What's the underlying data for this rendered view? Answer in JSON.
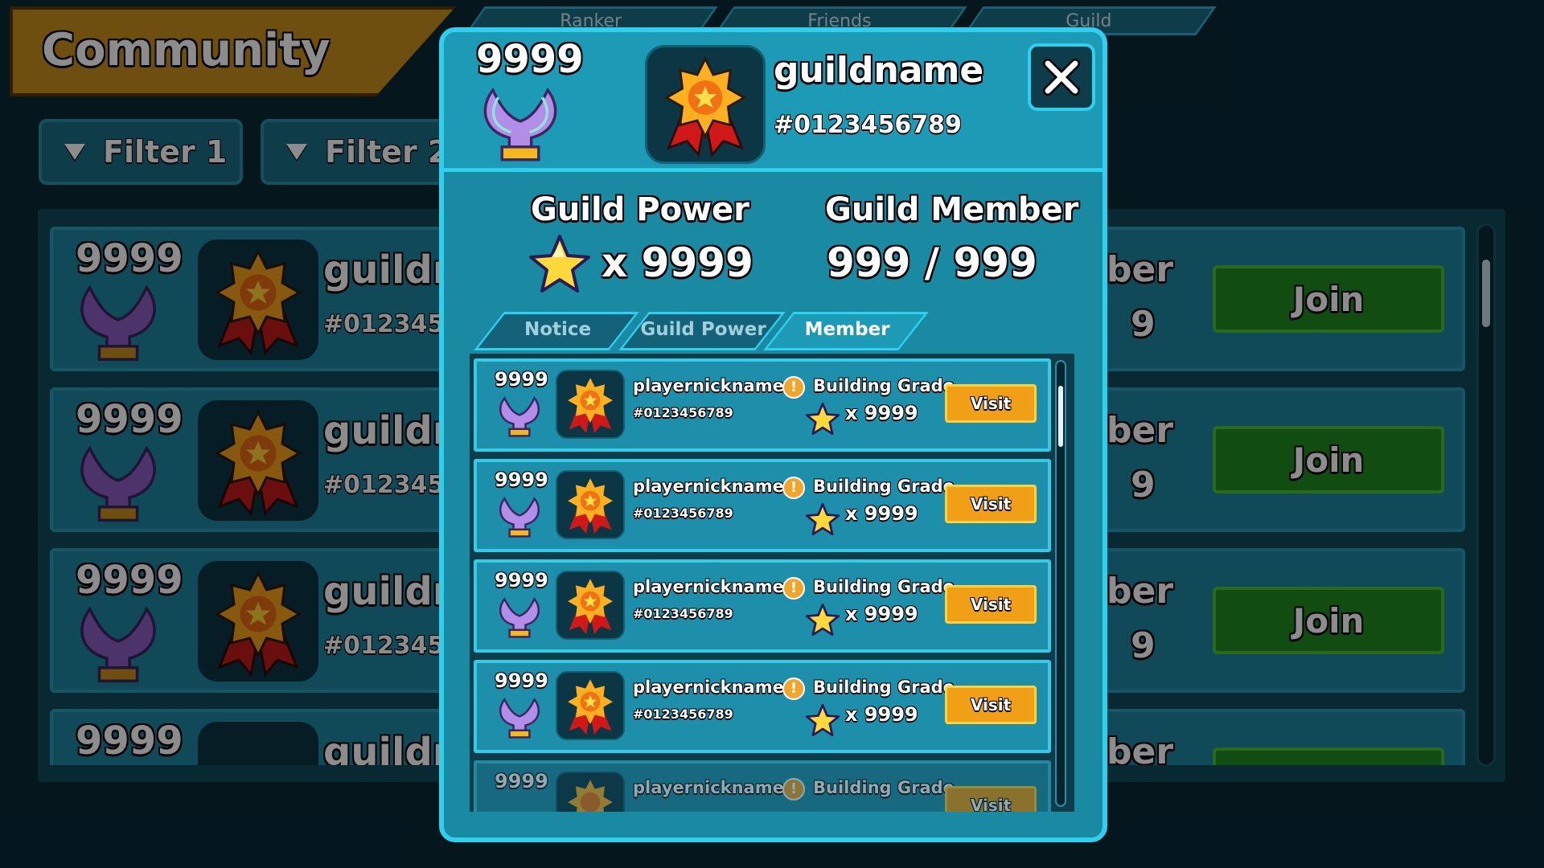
{
  "background": {
    "title": "Community",
    "tabs": [
      "Ranker",
      "Friends",
      "Guild"
    ],
    "filters": [
      "Filter 1",
      "Filter 2"
    ],
    "rows": [
      {
        "rank": "9999",
        "name": "guildnar",
        "id": "#01234567",
        "member_tail": "ber",
        "member_tail2": "9",
        "join_label": "Join"
      },
      {
        "rank": "9999",
        "name": "guildnar",
        "id": "#01234567",
        "member_tail": "ber",
        "member_tail2": "9",
        "join_label": "Join"
      },
      {
        "rank": "9999",
        "name": "guildnar",
        "id": "#01234567",
        "member_tail": "ber",
        "member_tail2": "9",
        "join_label": "Join"
      },
      {
        "rank": "9999",
        "name": "guildnar",
        "id": "",
        "member_tail": "ber",
        "member_tail2": "",
        "join_label": ""
      }
    ]
  },
  "modal": {
    "rank": "9999",
    "guild_name": "guildname",
    "guild_id": "#0123456789",
    "close_icon": "close-icon",
    "guild_power_label": "Guild Power",
    "guild_power_value": "x 9999",
    "guild_member_label": "Guild Member",
    "guild_member_value": "999 / 999",
    "tabs": [
      {
        "label": "Notice",
        "active": false
      },
      {
        "label": "Guild Power",
        "active": false
      },
      {
        "label": "Member",
        "active": true
      }
    ],
    "members": [
      {
        "rank": "9999",
        "nickname": "playernickname",
        "id": "#0123456789",
        "grade_label": "Building Grade",
        "power": "x 9999",
        "visit_label": "Visit"
      },
      {
        "rank": "9999",
        "nickname": "playernickname",
        "id": "#0123456789",
        "grade_label": "Building Grade",
        "power": "x 9999",
        "visit_label": "Visit"
      },
      {
        "rank": "9999",
        "nickname": "playernickname",
        "id": "#0123456789",
        "grade_label": "Building Grade",
        "power": "x 9999",
        "visit_label": "Visit"
      },
      {
        "rank": "9999",
        "nickname": "playernickname",
        "id": "#0123456789",
        "grade_label": "Building Grade",
        "power": "x 9999",
        "visit_label": "Visit"
      },
      {
        "rank": "9999",
        "nickname": "playernickname",
        "id": "",
        "grade_label": "Building Grade",
        "power": "",
        "visit_label": "Visit"
      }
    ]
  },
  "colors": {
    "accent": "#2fd0ee",
    "join_green": "#1f8c20",
    "visit_orange": "#f09f16",
    "banner_gold": "#c8901c"
  }
}
